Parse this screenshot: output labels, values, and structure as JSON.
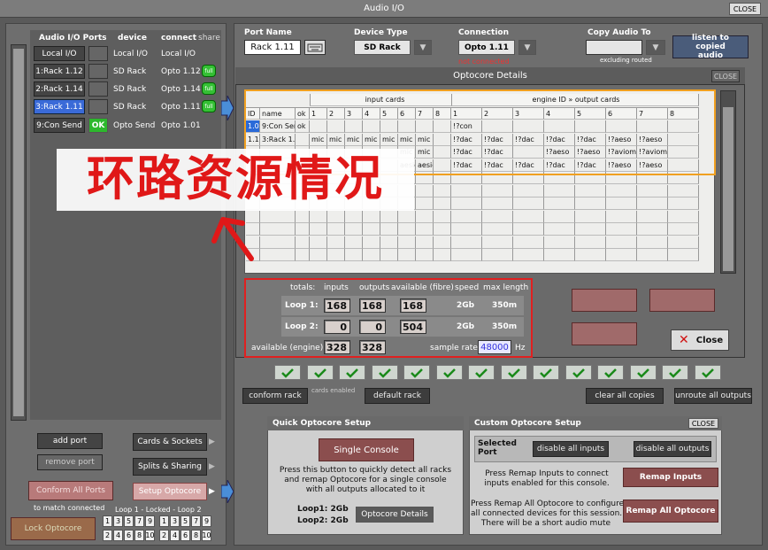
{
  "window": {
    "title": "Audio I/O",
    "close_label": "CLOSE"
  },
  "ports": {
    "headers": {
      "ports": "Audio I/O Ports",
      "device": "device",
      "connect": "connect",
      "share": "share"
    },
    "rows": [
      {
        "name": "Local I/O",
        "ok": "",
        "device": "Local I/O",
        "connect": "Local I/O",
        "share": "",
        "selected": false
      },
      {
        "name": "1:Rack 1.12",
        "ok": "",
        "device": "SD Rack",
        "connect": "Opto 1.12",
        "share": "full",
        "selected": false
      },
      {
        "name": "2:Rack 1.14",
        "ok": "",
        "device": "SD Rack",
        "connect": "Opto 1.14",
        "share": "full",
        "selected": false
      },
      {
        "name": "3:Rack 1.11",
        "ok": "",
        "device": "SD Rack",
        "connect": "Opto 1.11",
        "share": "full",
        "selected": true
      },
      {
        "name": "9:Con Send",
        "ok": "OK",
        "device": "Opto Send",
        "connect": "Opto 1.01",
        "share": "",
        "selected": false
      }
    ],
    "add_port": "add port",
    "remove_port": "remove port",
    "conform_all": "Conform All Ports",
    "to_match": "to match connected",
    "lock_opto": "Lock Optocore",
    "loop_label": "Loop 1 - Locked - Loop 2",
    "loop1_top": [
      "1",
      "3",
      "5",
      "7",
      "9"
    ],
    "loop1_bot": [
      "2",
      "4",
      "6",
      "8",
      "10"
    ],
    "loop2_top": [
      "1",
      "3",
      "5",
      "7",
      "9"
    ],
    "loop2_bot": [
      "2",
      "4",
      "6",
      "8",
      "10"
    ]
  },
  "side_tabs": [
    "Cards & Sockets",
    "Splits & Sharing",
    "Setup Optocore"
  ],
  "top": {
    "port_name_label": "Port Name",
    "port_name_value": "Rack 1.11",
    "device_type_label": "Device Type",
    "device_type_value": "SD Rack",
    "connection_label": "Connection",
    "connection_value": "Opto 1.11",
    "connection_status": "not connected",
    "copy_audio_label": "Copy Audio To",
    "copy_audio_value": "",
    "excluding_routed": "excluding routed",
    "listen_label": "listen to copied audio"
  },
  "optocore": {
    "title": "Optocore Details",
    "close_label": "CLOSE",
    "group_input": "input cards",
    "group_output": "engine ID » output cards",
    "columns": [
      "ID",
      "name",
      "ok",
      "1",
      "2",
      "3",
      "4",
      "5",
      "6",
      "7",
      "8",
      "1",
      "2",
      "3",
      "4",
      "5",
      "6",
      "7",
      "8"
    ],
    "rows": [
      [
        "1.01",
        "9:Con Send",
        "ok",
        "",
        "",
        "",
        "",
        "",
        "",
        "",
        "",
        "!?con",
        "",
        "",
        "",
        "",
        "",
        "",
        ""
      ],
      [
        "1.11",
        "3:Rack 1.11",
        "",
        "mic",
        "mic",
        "mic",
        "mic",
        "mic",
        "mic",
        "mic",
        "",
        "!?dac",
        "!?dac",
        "!?dac",
        "!?dac",
        "!?dac",
        "!?aeso",
        "!?aeso",
        ""
      ],
      [
        "",
        "",
        "",
        "",
        "",
        "",
        "",
        "",
        "mic",
        "mic",
        "",
        "!?dac",
        "!?dac",
        "",
        "!?aeso",
        "!?aeso",
        "!?aviom",
        "!?aviom",
        ""
      ],
      [
        "",
        "",
        "",
        "",
        "",
        "",
        "",
        "",
        "aesio",
        "aesio",
        "",
        "!?dac",
        "!?dac",
        "!?dac",
        "!?dac",
        "!?dac",
        "!?aeso",
        "!?aeso",
        ""
      ]
    ],
    "totals": {
      "h_totals": "totals:",
      "h_inputs": "inputs",
      "h_outputs": "outputs",
      "h_available": "available (fibre)",
      "h_speed": "speed",
      "h_max": "max length",
      "loop1_label": "Loop 1:",
      "loop1_inputs": "168",
      "loop1_outputs": "168",
      "loop1_available": "168",
      "loop1_speed": "2Gb",
      "loop1_max": "350m",
      "loop2_label": "Loop 2:",
      "loop2_inputs": "0",
      "loop2_outputs": "0",
      "loop2_available": "504",
      "loop2_speed": "2Gb",
      "loop2_max": "350m",
      "engine_label": "available (engine):",
      "engine_inputs": "328",
      "engine_outputs": "328",
      "sample_rate_label": "sample rate",
      "sample_rate_value": "48000",
      "hz": "Hz"
    },
    "close_btn": "Close"
  },
  "lower": {
    "conform_rack": "conform rack",
    "cards_enabled": "cards enabled",
    "default_rack": "default rack",
    "clear_copies": "clear all copies",
    "unroute": "unroute all outputs",
    "checkmarks": 14
  },
  "quick": {
    "title": "Quick Optocore Setup",
    "single_console": "Single Console",
    "desc": [
      "Press this button to quickly detect all racks",
      "and remap Optocore for a single console",
      "with all outputs allocated to it"
    ],
    "loop1": "Loop1: 2Gb",
    "loop2": "Loop2: 2Gb",
    "details": "Optocore Details"
  },
  "custom": {
    "title": "Custom Optocore Setup",
    "close_label": "CLOSE",
    "selected_port": "Selected Port",
    "disable_inputs": "disable all inputs",
    "disable_outputs": "disable all outputs",
    "remap_inputs_desc": [
      "Press Remap Inputs to connect",
      "inputs enabled for this console."
    ],
    "remap_inputs": "Remap Inputs",
    "remap_all_desc": [
      "Press Remap All Optocore to configure",
      "all connected devices for this session.",
      "There will be a short audio mute"
    ],
    "remap_all": "Remap All Optocore"
  },
  "overlay": {
    "text": "环路资源情况",
    "highlight_color": "#f0a020",
    "box_color": "#e02020"
  }
}
